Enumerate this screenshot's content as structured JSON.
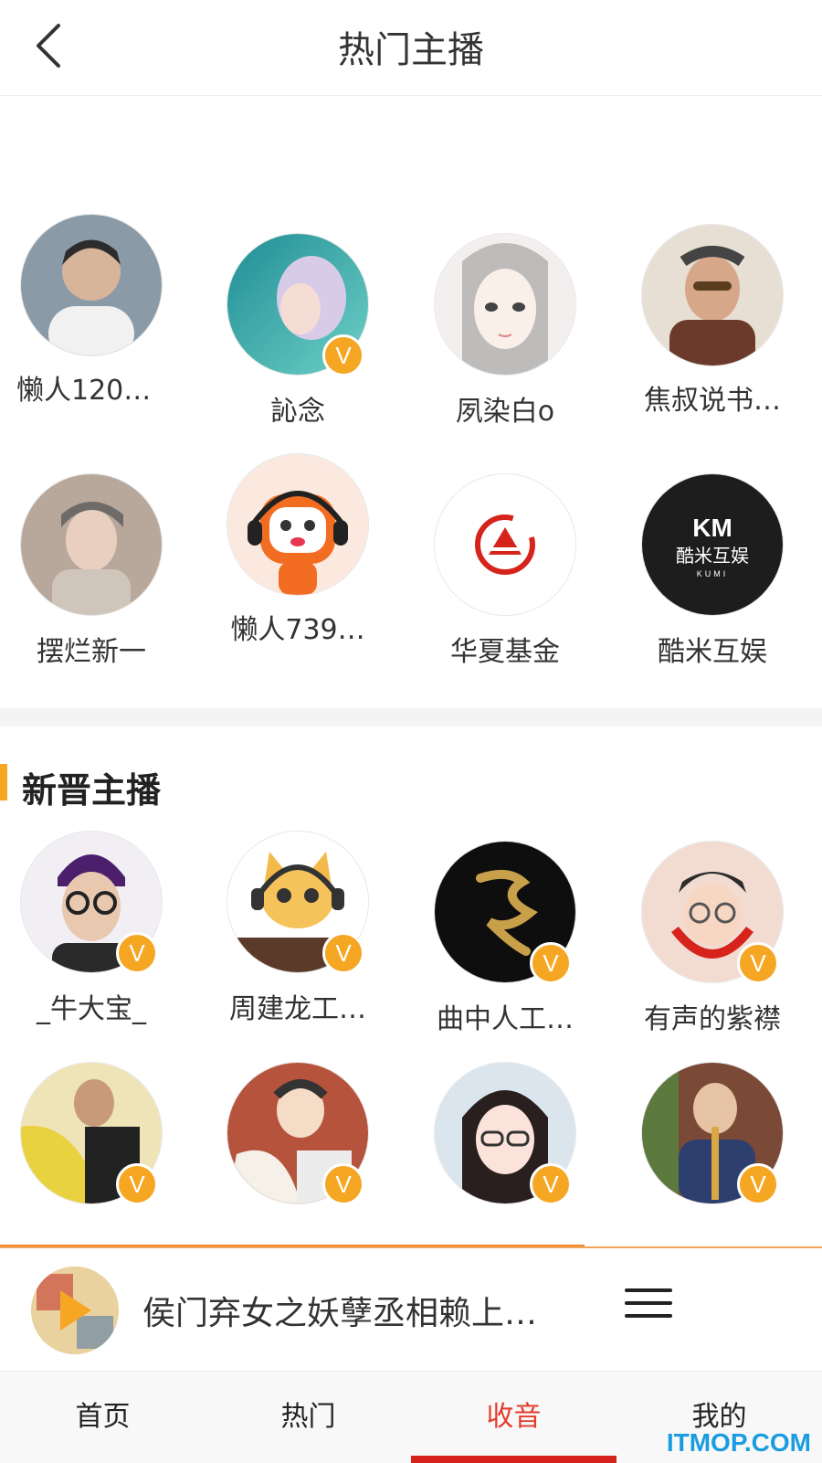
{
  "header": {
    "title": "热门主播"
  },
  "hot_anchors": [
    {
      "name": "懒人120…",
      "verified": false,
      "avatar_color": "#7a8a96"
    },
    {
      "name": "訫念",
      "verified": true,
      "avatar_color": "#2aa3a6"
    },
    {
      "name": "夙染白o",
      "verified": false,
      "avatar_color": "#f0eaea"
    },
    {
      "name": "焦叔说书…",
      "verified": false,
      "avatar_color": "#b27b5c"
    },
    {
      "name": "摆烂新一",
      "verified": false,
      "avatar_color": "#9b8e86"
    },
    {
      "name": "懒人739…",
      "verified": false,
      "avatar_color": "#fbe9df"
    },
    {
      "name": "华夏基金",
      "verified": false,
      "avatar_color": "#ffffff"
    },
    {
      "name": "酷米互娱",
      "verified": false,
      "avatar_color": "#1d1d1d"
    }
  ],
  "logo_text": {
    "kumi_top": "KM",
    "kumi_cn": "酷米互娱",
    "kumi_en": "KUMI"
  },
  "new_section": {
    "title": "新晋主播"
  },
  "new_anchors": [
    {
      "name": "_牛大宝_",
      "verified": true,
      "avatar_color": "#dcd6e6"
    },
    {
      "name": "周建龙工…",
      "verified": true,
      "avatar_color": "#f2c98a"
    },
    {
      "name": "曲中人工…",
      "verified": true,
      "avatar_color": "#111111"
    },
    {
      "name": "有声的紫襟",
      "verified": true,
      "avatar_color": "#e7c3b7"
    },
    {
      "name": "",
      "verified": true,
      "avatar_color": "#e8d34a"
    },
    {
      "name": "",
      "verified": true,
      "avatar_color": "#b6533c"
    },
    {
      "name": "",
      "verified": true,
      "avatar_color": "#d9e4ef"
    },
    {
      "name": "",
      "verified": true,
      "avatar_color": "#3d5a3a"
    }
  ],
  "badge": {
    "text": "V"
  },
  "player": {
    "track": "侯门弃女之妖孽丞相赖上…"
  },
  "nav": {
    "tabs": [
      "首页",
      "热门",
      "收音",
      "我的"
    ],
    "active": 2
  },
  "watermark": "ITMOP.COM",
  "colors": {
    "accent": "#f5a623",
    "active_tab": "#e43b2c",
    "indicator": "#d6231b"
  }
}
